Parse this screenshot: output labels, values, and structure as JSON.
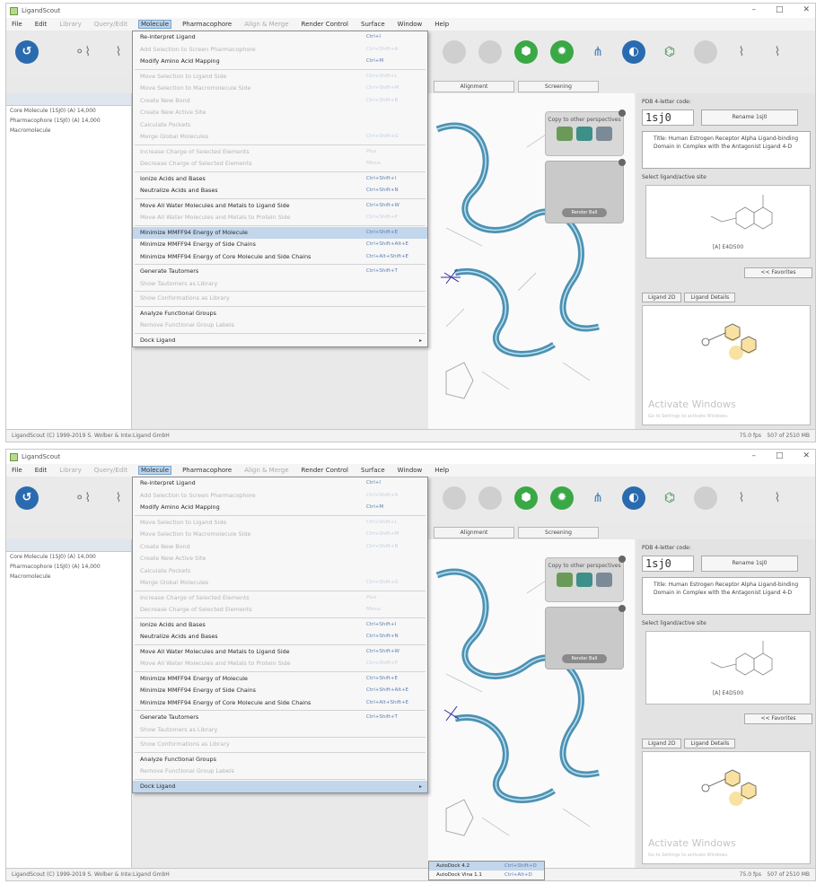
{
  "window": {
    "title": "LigandScout",
    "controls": [
      "–",
      "□",
      "✕"
    ]
  },
  "menubar": {
    "items": [
      {
        "label": "File",
        "disabled": false
      },
      {
        "label": "Edit",
        "disabled": false
      },
      {
        "label": "Library",
        "disabled": true
      },
      {
        "label": "Query/Edit",
        "disabled": true
      },
      {
        "label": "Molecule",
        "disabled": false,
        "active": true
      },
      {
        "label": "Pharmacophore",
        "disabled": false
      },
      {
        "label": "Align & Merge",
        "disabled": true
      },
      {
        "label": "Render Control",
        "disabled": false
      },
      {
        "label": "Surface",
        "disabled": false
      },
      {
        "label": "Window",
        "disabled": false
      },
      {
        "label": "Help",
        "disabled": false
      }
    ]
  },
  "toolbar": {
    "icons": [
      "back-icon",
      "molecule-icon",
      "molecule-icon",
      "disabled-icon",
      "disabled-icon",
      "green-icon",
      "green-icon",
      "network-icon",
      "blue-icon",
      "molecule-icon",
      "disabled-icon",
      "molecule-icon",
      "molecule-icon"
    ]
  },
  "workspace_tabs": [
    "Alignment",
    "Screening"
  ],
  "tree": {
    "items": [
      "Core Molecule (1SJ0) (A) 14,000",
      "Pharmacophore (1SJ0) (A) 14,000",
      "Macromolecule"
    ]
  },
  "viewer": {
    "copy_label": "Copy to\nother perspectives",
    "render_button": "Render Ball"
  },
  "right_panel": {
    "pdb_label": "PDB 4-letter code:",
    "pdb_code": "1sj0",
    "rename_button": "Rename 1sj0",
    "title_text": "Title: Human Estrogen Receptor Alpha Ligand-binding Domain in Complex with the Antagonist Ligand 4-D",
    "site_label": "Select ligand/active site",
    "ligand_id": "[A] E4D500",
    "favorites_button": "<< Favorites",
    "ligand_tabs": [
      "Ligand 2D",
      "Ligand Details"
    ],
    "watermark": "Activate Windows",
    "watermark_sub": "Go to Settings to activate Windows."
  },
  "status": {
    "left": "LigandScout (C) 1999-2019 S. Wolber & Inte:Ligand GmbH",
    "mid": "75.0 fps",
    "right": "507 of 2510 MB"
  },
  "molecule_menu": {
    "items": [
      {
        "label": "Re-interpret Ligand",
        "shortcut": "Ctrl+I",
        "disabled": false
      },
      {
        "label": "Add Selection to Screen Pharmacophore",
        "shortcut": "Ctrl+Shift+A",
        "disabled": true
      },
      {
        "label": "Modify Amino Acid Mapping",
        "shortcut": "Ctrl+M",
        "disabled": false
      },
      {
        "sep": true
      },
      {
        "label": "Move Selection to Ligand Side",
        "shortcut": "Ctrl+Shift+L",
        "disabled": true
      },
      {
        "label": "Move Selection to Macromolecule Side",
        "shortcut": "Ctrl+Shift+M",
        "disabled": true
      },
      {
        "label": "Create New Bond",
        "shortcut": "Ctrl+Shift+B",
        "disabled": true
      },
      {
        "label": "Create New Active Site",
        "shortcut": "",
        "disabled": true
      },
      {
        "label": "Calculate Pockets",
        "shortcut": "",
        "disabled": true
      },
      {
        "label": "Merge Global Molecules",
        "shortcut": "Ctrl+Shift+G",
        "disabled": true
      },
      {
        "sep": true
      },
      {
        "label": "Increase Charge of Selected Elements",
        "shortcut": "Plus",
        "disabled": true
      },
      {
        "label": "Decrease Charge of Selected Elements",
        "shortcut": "Minus",
        "disabled": true
      },
      {
        "sep": true
      },
      {
        "label": "Ionize Acids and Bases",
        "shortcut": "Ctrl+Shift+I",
        "disabled": false
      },
      {
        "label": "Neutralize Acids and Bases",
        "shortcut": "Ctrl+Shift+N",
        "disabled": false
      },
      {
        "sep": true
      },
      {
        "label": "Move All Water Molecules and Metals to Ligand Side",
        "shortcut": "Ctrl+Shift+W",
        "disabled": false
      },
      {
        "label": "Move All Water Molecules and Metals to Protein Side",
        "shortcut": "Ctrl+Shift+P",
        "disabled": true
      },
      {
        "sep": true
      },
      {
        "label": "Minimize MMFF94 Energy of Molecule",
        "shortcut": "Ctrl+Shift+E",
        "disabled": false,
        "highlight": true
      },
      {
        "label": "Minimize MMFF94 Energy of Side Chains",
        "shortcut": "Ctrl+Shift+Alt+E",
        "disabled": false
      },
      {
        "label": "Minimize MMFF94 Energy of Core Molecule and Side Chains",
        "shortcut": "Ctrl+Alt+Shift+E",
        "disabled": false
      },
      {
        "sep": true
      },
      {
        "label": "Generate Tautomers",
        "shortcut": "Ctrl+Shift+T",
        "disabled": false
      },
      {
        "label": "Show Tautomers as Library",
        "shortcut": "",
        "disabled": true
      },
      {
        "sep": true
      },
      {
        "label": "Show Conformations as Library",
        "shortcut": "",
        "disabled": true
      },
      {
        "sep": true
      },
      {
        "label": "Analyze Functional Groups",
        "shortcut": "",
        "disabled": false
      },
      {
        "label": "Remove Functional Group Labels",
        "shortcut": "",
        "disabled": true
      },
      {
        "sep": true
      },
      {
        "label": "Dock Ligand",
        "shortcut": "",
        "disabled": false,
        "submenu": true
      }
    ]
  },
  "dock_submenu": {
    "items": [
      {
        "label": "AutoDock 4.2",
        "shortcut": "Ctrl+Shift+D"
      },
      {
        "label": "AutoDock Vina 1.1",
        "shortcut": "Ctrl+Alt+D"
      }
    ]
  }
}
